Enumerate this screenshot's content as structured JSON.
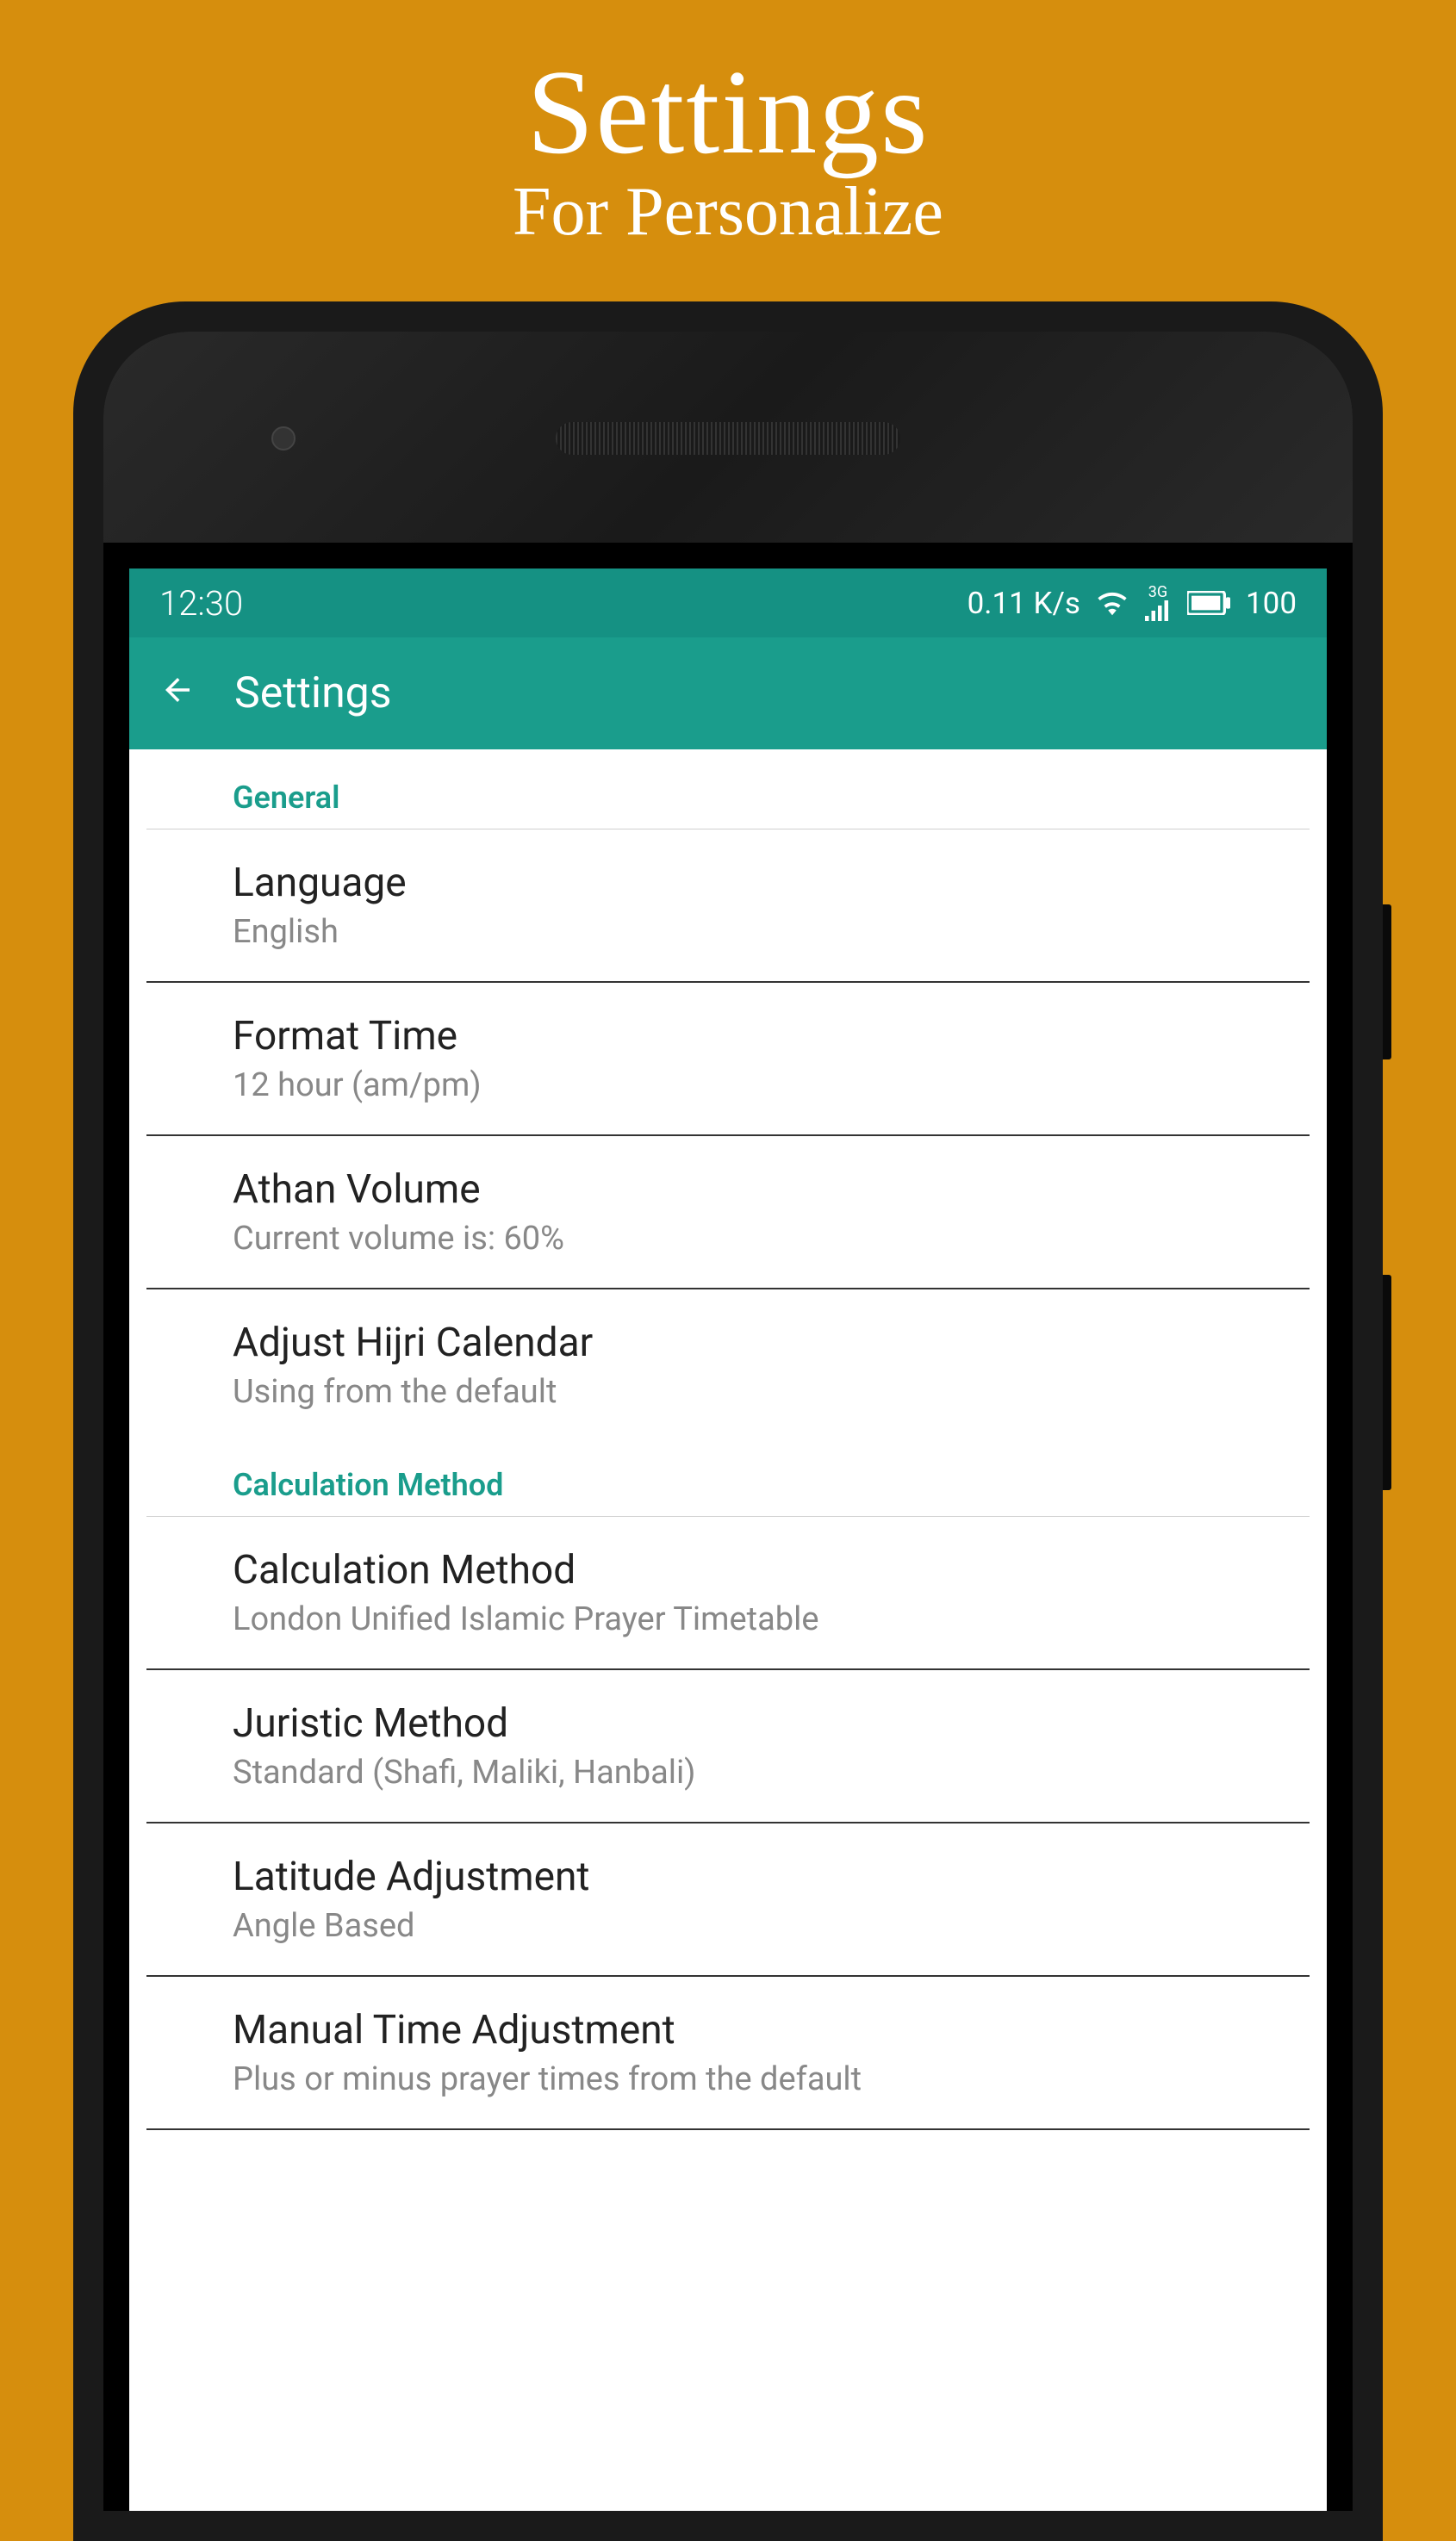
{
  "promo": {
    "title": "Settings",
    "subtitle": "For Personalize"
  },
  "statusBar": {
    "time": "12:30",
    "dataRate": "0.11 K/s",
    "networkType": "3G",
    "battery": "100"
  },
  "header": {
    "title": "Settings"
  },
  "sections": [
    {
      "name": "General",
      "items": [
        {
          "title": "Language",
          "value": "English"
        },
        {
          "title": "Format Time",
          "value": "12 hour (am/pm)"
        },
        {
          "title": "Athan Volume",
          "value": "Current volume is: 60%"
        },
        {
          "title": "Adjust Hijri Calendar",
          "value": "Using from the default"
        }
      ]
    },
    {
      "name": "Calculation Method",
      "items": [
        {
          "title": "Calculation Method",
          "value": "London Unified Islamic Prayer Timetable"
        },
        {
          "title": "Juristic Method",
          "value": "Standard (Shafi, Maliki, Hanbali)"
        },
        {
          "title": "Latitude Adjustment",
          "value": "Angle Based"
        },
        {
          "title": "Manual Time Adjustment",
          "value": "Plus or minus prayer times from the default"
        }
      ]
    }
  ]
}
